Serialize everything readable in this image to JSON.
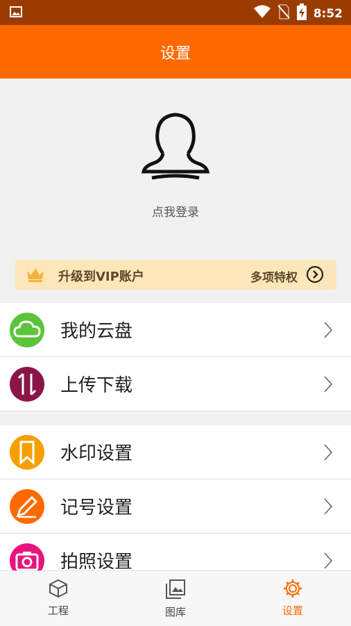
{
  "status_bar": {
    "time": "8:52",
    "icons": [
      "image-icon",
      "wifi-icon",
      "no-sim-icon",
      "battery-charging-icon"
    ]
  },
  "app_bar": {
    "title": "设置"
  },
  "profile": {
    "login_text": "点我登录"
  },
  "vip": {
    "title": "升级到VIP账户",
    "more": "多项特权",
    "accent": "#fde6b9"
  },
  "menu": {
    "group1": [
      {
        "label": "我的云盘",
        "icon": "cloud-icon",
        "color": "#5cc43a"
      },
      {
        "label": "上传下载",
        "icon": "transfer-icon",
        "color": "#8b1547"
      }
    ],
    "group2": [
      {
        "label": "水印设置",
        "icon": "bookmark-icon",
        "color": "#f5a000"
      },
      {
        "label": "记号设置",
        "icon": "pencil-icon",
        "color": "#ff6a00"
      },
      {
        "label": "拍照设置",
        "icon": "camera-icon",
        "color": "#e8137e"
      }
    ]
  },
  "tabs": [
    {
      "label": "工程",
      "icon": "cube-icon"
    },
    {
      "label": "图库",
      "icon": "gallery-icon"
    },
    {
      "label": "设置",
      "icon": "gear-icon",
      "active": true
    }
  ],
  "colors": {
    "primary": "#ff6a00",
    "status_bar": "#9a3c00"
  }
}
